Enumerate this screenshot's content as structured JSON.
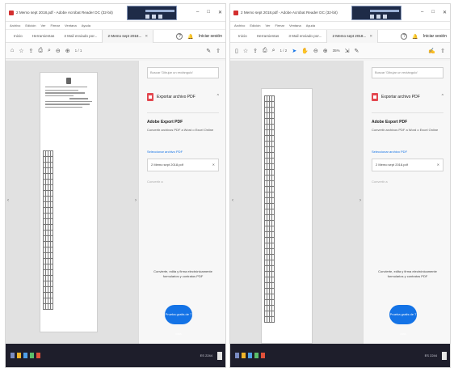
{
  "left": {
    "window_title": "2 Memo sept 2018.pdf - Adobe Acrobat Reader DC (32-bit)",
    "menu": [
      "Archivo",
      "Edición",
      "Ver",
      "Firmar",
      "Ventana",
      "Ayuda"
    ],
    "tabs": [
      {
        "label": "Inicio"
      },
      {
        "label": "Herramientas"
      },
      {
        "label": "3 Mail enviado por..."
      },
      {
        "label": "2 Memo sept 2018..."
      }
    ],
    "signin": "Iniciar sesión",
    "page_indicator": "1 / 1",
    "search_placeholder": "Buscar 'Dibujar un rectángulo'",
    "export_title": "Exportar archivo PDF",
    "subtitle": "Adobe Export PDF",
    "desc": "Convertir archivos PDF a Word o Excel Online",
    "select_link": "Seleccionar archivo PDF",
    "file_name": "2 Memo sept 2018.pdf",
    "faded_label": "Convertir a",
    "promo": "Convierte, edita y firma electrónicamente formularios y contratos PDF",
    "cta": "Prueba gratis de 7 días",
    "tray": "ES 2244"
  },
  "right": {
    "window_title": "2 Memo sept 2018.pdf - Adobe Acrobat Reader DC (32-bit)",
    "menu": [
      "Archivo",
      "Edición",
      "Ver",
      "Firmar",
      "Ventana",
      "Ayuda"
    ],
    "tabs": [
      {
        "label": "Inicio"
      },
      {
        "label": "Herramientas"
      },
      {
        "label": "3 Mail enviado por..."
      },
      {
        "label": "2 Memo sept 2018..."
      }
    ],
    "signin": "Iniciar sesión",
    "page_indicator": "1 / 2",
    "zoom": "35%",
    "search_placeholder": "Buscar 'Dibujar un rectángulo'",
    "export_title": "Exportar archivo PDF",
    "subtitle": "Adobe Export PDF",
    "desc": "Convertir archivos PDF a Word o Excel Online",
    "select_link": "Seleccionar archivo PDF",
    "file_name": "2 Memo sept 2018.pdf",
    "faded_label": "Convertir a",
    "promo": "Convierte, edita y firma electrónicamente formularios y contratos PDF",
    "cta": "Prueba gratis de 7 días",
    "tray": "ES 2244"
  },
  "colors": {
    "accent": "#1473e6",
    "pdf_red": "#e34850",
    "taskbar": "#1e1e2b"
  },
  "icons": [
    "home-icon",
    "star-icon",
    "upload-icon",
    "print-icon",
    "search-icon",
    "zoom-out-icon",
    "zoom-in-icon",
    "cursor-icon",
    "hand-icon",
    "comment-icon",
    "pen-icon",
    "share-icon",
    "close-icon",
    "help-icon",
    "bell-icon"
  ]
}
